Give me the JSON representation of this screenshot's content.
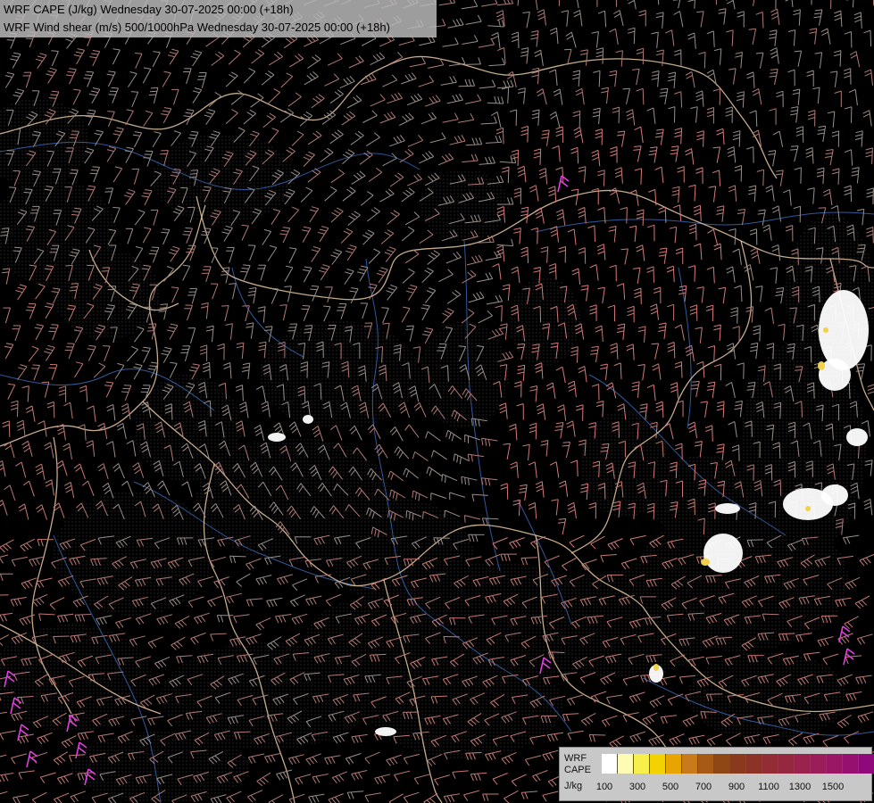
{
  "header": {
    "line1": "WRF CAPE (J/kg) Wednesday 30-07-2025 00:00 (+18h)",
    "line2": "WRF Wind shear (m/s) 500/1000hPa Wednesday 30-07-2025 00:00 (+18h)"
  },
  "legend": {
    "title_line1": "WRF",
    "title_line2": "CAPE",
    "unit": "J/kg",
    "colors": [
      "#ffffff",
      "#fefcb4",
      "#f7f04a",
      "#f2d200",
      "#e8a400",
      "#c97b1c",
      "#a65a16",
      "#8f4716",
      "#8a3a1c",
      "#8c3226",
      "#922d35",
      "#952840",
      "#99234d",
      "#9b1d5a",
      "#9a1765",
      "#961070",
      "#90097a"
    ],
    "tick_labels": [
      "100",
      "300",
      "500",
      "700",
      "900",
      "1100",
      "1300",
      "1500"
    ]
  },
  "map": {
    "background_color": "#000000",
    "border_color": "#e7c9a5",
    "river_color": "#3f6fc0",
    "barb_colors": [
      "#9a8e8a",
      "#b07a78",
      "#c47a74",
      "#d47a7a",
      "#e06a90",
      "#e040e0"
    ]
  }
}
